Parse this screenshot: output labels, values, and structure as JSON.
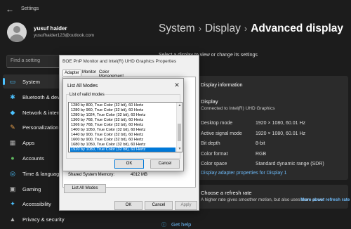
{
  "window": {
    "title": "Settings"
  },
  "user": {
    "name": "yusuf haider",
    "email": "yusufhaider123@outlook.com"
  },
  "search": {
    "placeholder": "Find a setting"
  },
  "nav": [
    {
      "label": "System",
      "icon": "monitor-icon",
      "color": "#4cc2ff"
    },
    {
      "label": "Bluetooth & devices",
      "icon": "bluetooth-icon",
      "color": "#4cc2ff"
    },
    {
      "label": "Network & internet",
      "icon": "wifi-icon",
      "color": "#4cc2ff"
    },
    {
      "label": "Personalization",
      "icon": "brush-icon",
      "color": "#e8a04c"
    },
    {
      "label": "Apps",
      "icon": "apps-icon",
      "color": "#b0b0b0"
    },
    {
      "label": "Accounts",
      "icon": "person-icon",
      "color": "#5fb85f"
    },
    {
      "label": "Time & language",
      "icon": "globe-icon",
      "color": "#4cc2ff"
    },
    {
      "label": "Gaming",
      "icon": "gamepad-icon",
      "color": "#b0b0b0"
    },
    {
      "label": "Accessibility",
      "icon": "accessibility-icon",
      "color": "#4cc2ff"
    },
    {
      "label": "Privacy & security",
      "icon": "shield-icon",
      "color": "#b0b0b0"
    }
  ],
  "header": {
    "part1": "System",
    "part2": "Display",
    "part3": "Advanced display"
  },
  "main": {
    "select_display": "Select a display to view or change its settings",
    "info_section": "Display information",
    "display_name": "Display",
    "connected_to": "Connected to Intel(R) UHD Graphics",
    "rows": [
      {
        "label": "Desktop mode",
        "value": "1920 × 1080, 60.01 Hz"
      },
      {
        "label": "Active signal mode",
        "value": "1920 × 1080, 60.01 Hz"
      },
      {
        "label": "Bit depth",
        "value": "8-bit"
      },
      {
        "label": "Color format",
        "value": "RGB"
      },
      {
        "label": "Color space",
        "value": "Standard dynamic range (SDR)"
      }
    ],
    "adapter_link": "Display adapter properties for Display 1",
    "refresh_title": "Choose a refresh rate",
    "refresh_desc": "A higher rate gives smoother motion, but also uses more power",
    "refresh_link": "More about refresh rate",
    "get_help": "Get help"
  },
  "props_dialog": {
    "title": "BOE PnP Monitor and Intel(R) UHD Graphics Properties",
    "tabs": [
      "Adapter",
      "Monitor",
      "Color Management"
    ],
    "shared_memory_label": "Shared System Memory:",
    "shared_memory_value": "4012 MB",
    "list_all_modes": "List All Modes",
    "ok": "OK",
    "cancel": "Cancel",
    "apply": "Apply"
  },
  "modes_dialog": {
    "title": "List All Modes",
    "group_label": "List of valid modes",
    "modes": [
      "1280 by 800, True Color (32 bit), 60 Hertz",
      "1280 by 960, True Color (32 bit), 60 Hertz",
      "1280 by 1024, True Color (32 bit), 60 Hertz",
      "1360 by 768, True Color (32 bit), 60 Hertz",
      "1366 by 768, True Color (32 bit), 60 Hertz",
      "1400 by 1050, True Color (32 bit), 60 Hertz",
      "1440 by 900, True Color (32 bit), 60 Hertz",
      "1600 by 900, True Color (32 bit), 60 Hertz",
      "1680 by 1050, True Color (32 bit), 60 Hertz",
      "1920 by 1080, True Color (32 bit), 60 Hertz"
    ],
    "selected_index": 9,
    "ok": "OK",
    "cancel": "Cancel"
  },
  "colors": {
    "accent": "#4cc2ff",
    "selection": "#0078d7",
    "link": "#6cb8f6"
  }
}
